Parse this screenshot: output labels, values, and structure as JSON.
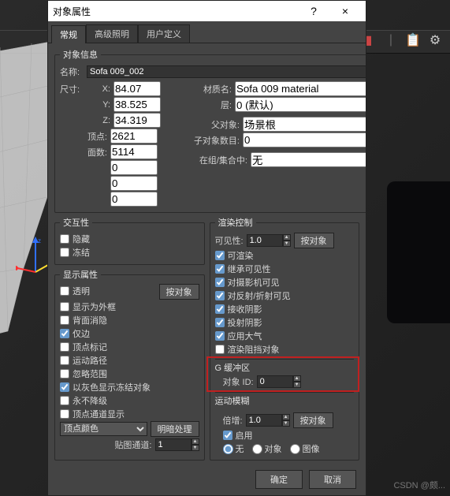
{
  "window": {
    "title": "对象属性",
    "help": "?",
    "close": "×"
  },
  "tabs": [
    "常规",
    "高级照明",
    "用户定义"
  ],
  "info": {
    "legend": "对象信息",
    "name_label": "名称:",
    "name_value": "Sofa 009_002",
    "size_label": "尺寸:",
    "x_label": "X:",
    "x": "84.07",
    "y_label": "Y:",
    "y": "38.525",
    "z_label": "Z:",
    "z": "34.319",
    "vertices_label": "顶点:",
    "vertices": "2621",
    "faces_label": "面数:",
    "faces": "5114",
    "extra0": "0",
    "extra1": "0",
    "extra2": "0",
    "material_label": "材质名:",
    "material_value": "Sofa 009 material",
    "layer_label": "层:",
    "layer_value": "0 (默认)",
    "parent_label": "父对象:",
    "parent_value": "场景根",
    "children_label": "子对象数目:",
    "children_value": "0",
    "group_label": "在组/集合中:",
    "group_value": "无"
  },
  "interact": {
    "legend": "交互性",
    "hide": "隐藏",
    "freeze": "冻结"
  },
  "display": {
    "legend": "显示属性",
    "transparent": "透明",
    "by_object": "按对象",
    "show_as_frame": "显示为外框",
    "backface_cull": "背面消隐",
    "edges_only": "仅边",
    "vertex_ticks": "顶点标记",
    "motion_path": "运动路径",
    "ignore_range": "忽略范围",
    "gray_frozen": "以灰色显示冻结对象",
    "never_degrade": "永不降级",
    "vertex_channel": "顶点通道显示",
    "vertex_color": "顶点颜色",
    "shaded": "明暗处理",
    "map_channel_label": "贴图通道:",
    "map_channel_value": "1"
  },
  "render": {
    "legend": "渲染控制",
    "visibility_label": "可见性:",
    "visibility_value": "1.0",
    "by_object": "按对象",
    "renderable": "可渲染",
    "inherit_vis": "继承可见性",
    "visible_to_cam": "对摄影机可见",
    "visible_to_refl": "对反射/折射可见",
    "receive_shadow": "接收阴影",
    "cast_shadow": "投射阴影",
    "apply_atmos": "应用大气",
    "render_occluded": "渲染阻挡对象",
    "gbuffer_label": "G 缓冲区",
    "object_id_label": "对象 ID:",
    "object_id_value": "0",
    "motion_blur_label": "运动模糊",
    "multiplier_label": "倍增:",
    "multiplier_value": "1.0",
    "enable": "启用",
    "none": "无",
    "object": "对象",
    "image": "图像"
  },
  "footer": {
    "ok": "确定",
    "cancel": "取消"
  },
  "watermark": "CSDN @颇..."
}
